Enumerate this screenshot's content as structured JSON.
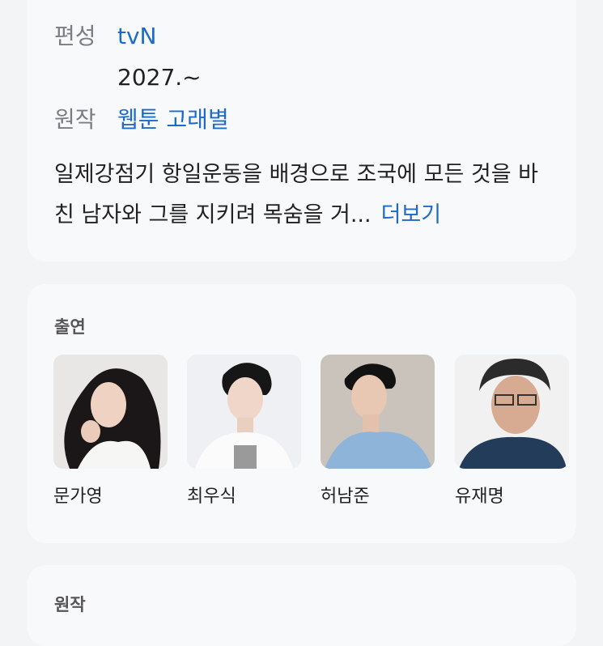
{
  "info": {
    "broadcast_label": "편성",
    "broadcast_value": "tvN",
    "broadcast_date": "2027.~",
    "original_label": "원작",
    "original_value": "웹툰 고래별",
    "description": "일제강점기 항일운동을 배경으로 조국에 모든 것을 바친 남자와 그를 지키려 목숨을 거...",
    "more_label": "더보기"
  },
  "cast": {
    "title": "출연",
    "members": [
      {
        "name": "문가영"
      },
      {
        "name": "최우식"
      },
      {
        "name": "허남준"
      },
      {
        "name": "유재명"
      }
    ]
  },
  "original_section": {
    "title": "원작"
  }
}
